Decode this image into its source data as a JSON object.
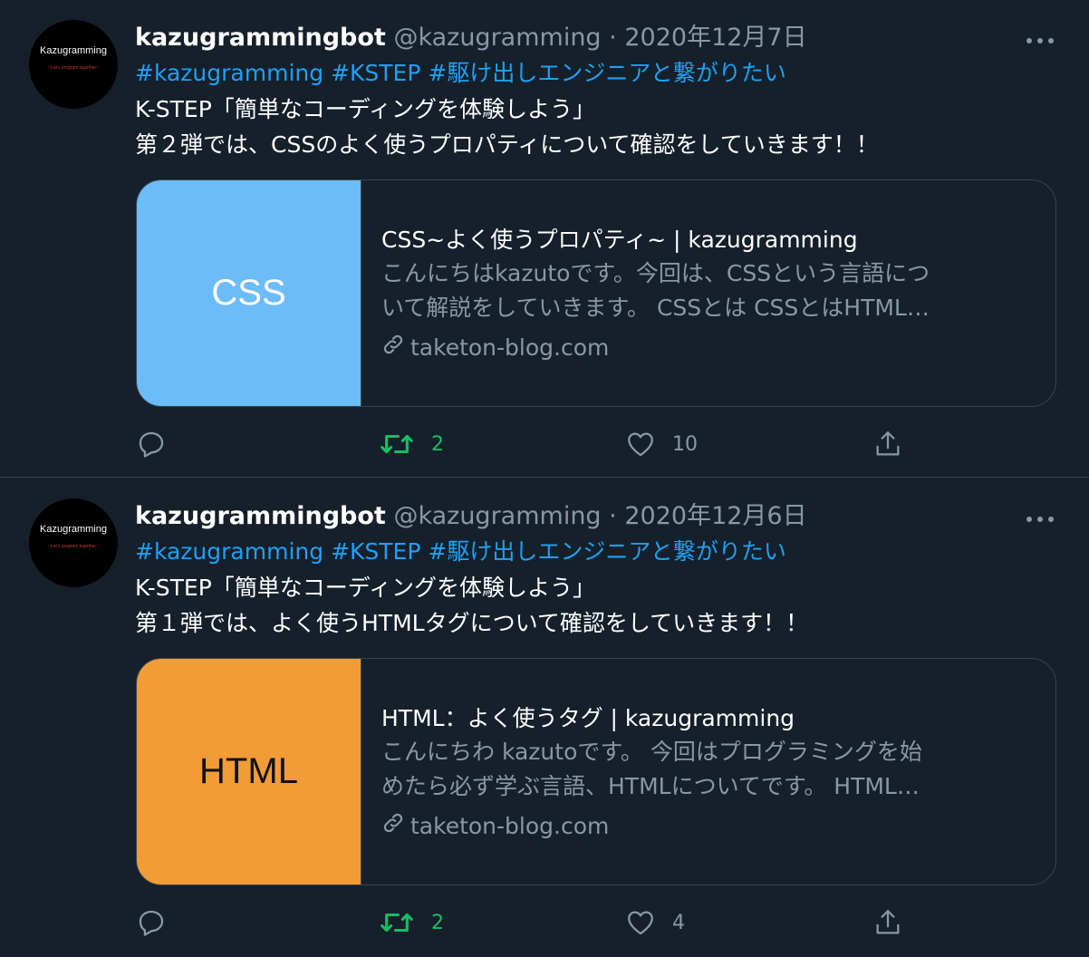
{
  "tweets": [
    {
      "avatar": {
        "name": "Kazugramming",
        "tagline": "~Let's program together~"
      },
      "display_name": "kazugrammingbot",
      "handle": "@kazugramming",
      "separator": "·",
      "date": "2020年12月7日",
      "more_icon": "ellipsis-icon",
      "hashtags": [
        "#kazugramming",
        "#KSTEP",
        "#駆け出しエンジニアと繋がりたい"
      ],
      "lines": [
        "K-STEP「簡単なコーディングを体験しよう」",
        "第２弾では、CSSのよく使うプロパティについて確認をしていきます！！"
      ],
      "card": {
        "thumb_text": "CSS",
        "thumb_bg": "#6bbcf7",
        "thumb_fg": "#ffffff",
        "title": "CSS~よく使うプロパティ~ | kazugramming",
        "desc_line1": "こんにちはkazutoです。今回は、CSSという言語につ",
        "desc_line2": "いて解説をしていきます。 CSSとは CSSとはHTML…",
        "domain": "taketon-blog.com"
      },
      "actions": {
        "reply_icon": "reply-icon",
        "retweet_icon": "retweet-icon",
        "retweet_count": "2",
        "like_icon": "heart-icon",
        "like_count": "10",
        "share_icon": "share-icon"
      }
    },
    {
      "avatar": {
        "name": "Kazugramming",
        "tagline": "~Let's program together~"
      },
      "display_name": "kazugrammingbot",
      "handle": "@kazugramming",
      "separator": "·",
      "date": "2020年12月6日",
      "more_icon": "ellipsis-icon",
      "hashtags": [
        "#kazugramming",
        "#KSTEP",
        "#駆け出しエンジニアと繋がりたい"
      ],
      "lines": [
        "K-STEP「簡単なコーディングを体験しよう」",
        "第１弾では、よく使うHTMLタグについて確認をしていきます！！"
      ],
      "card": {
        "thumb_text": "HTML",
        "thumb_bg": "#f29c38",
        "thumb_fg": "#111111",
        "title": "HTML：よく使うタグ | kazugramming",
        "desc_line1": "こんにちわ kazutoです。 今回はプログラミングを始",
        "desc_line2": "めたら必ず学ぶ言語、HTMLについてです。 HTML…",
        "domain": "taketon-blog.com"
      },
      "actions": {
        "reply_icon": "reply-icon",
        "retweet_icon": "retweet-icon",
        "retweet_count": "2",
        "like_icon": "heart-icon",
        "like_count": "4",
        "share_icon": "share-icon"
      }
    }
  ],
  "colors": {
    "background": "#15202b",
    "hashtag": "#1da1f2",
    "muted": "#8899a6",
    "retweeted": "#17bf63",
    "border": "#38444d"
  }
}
